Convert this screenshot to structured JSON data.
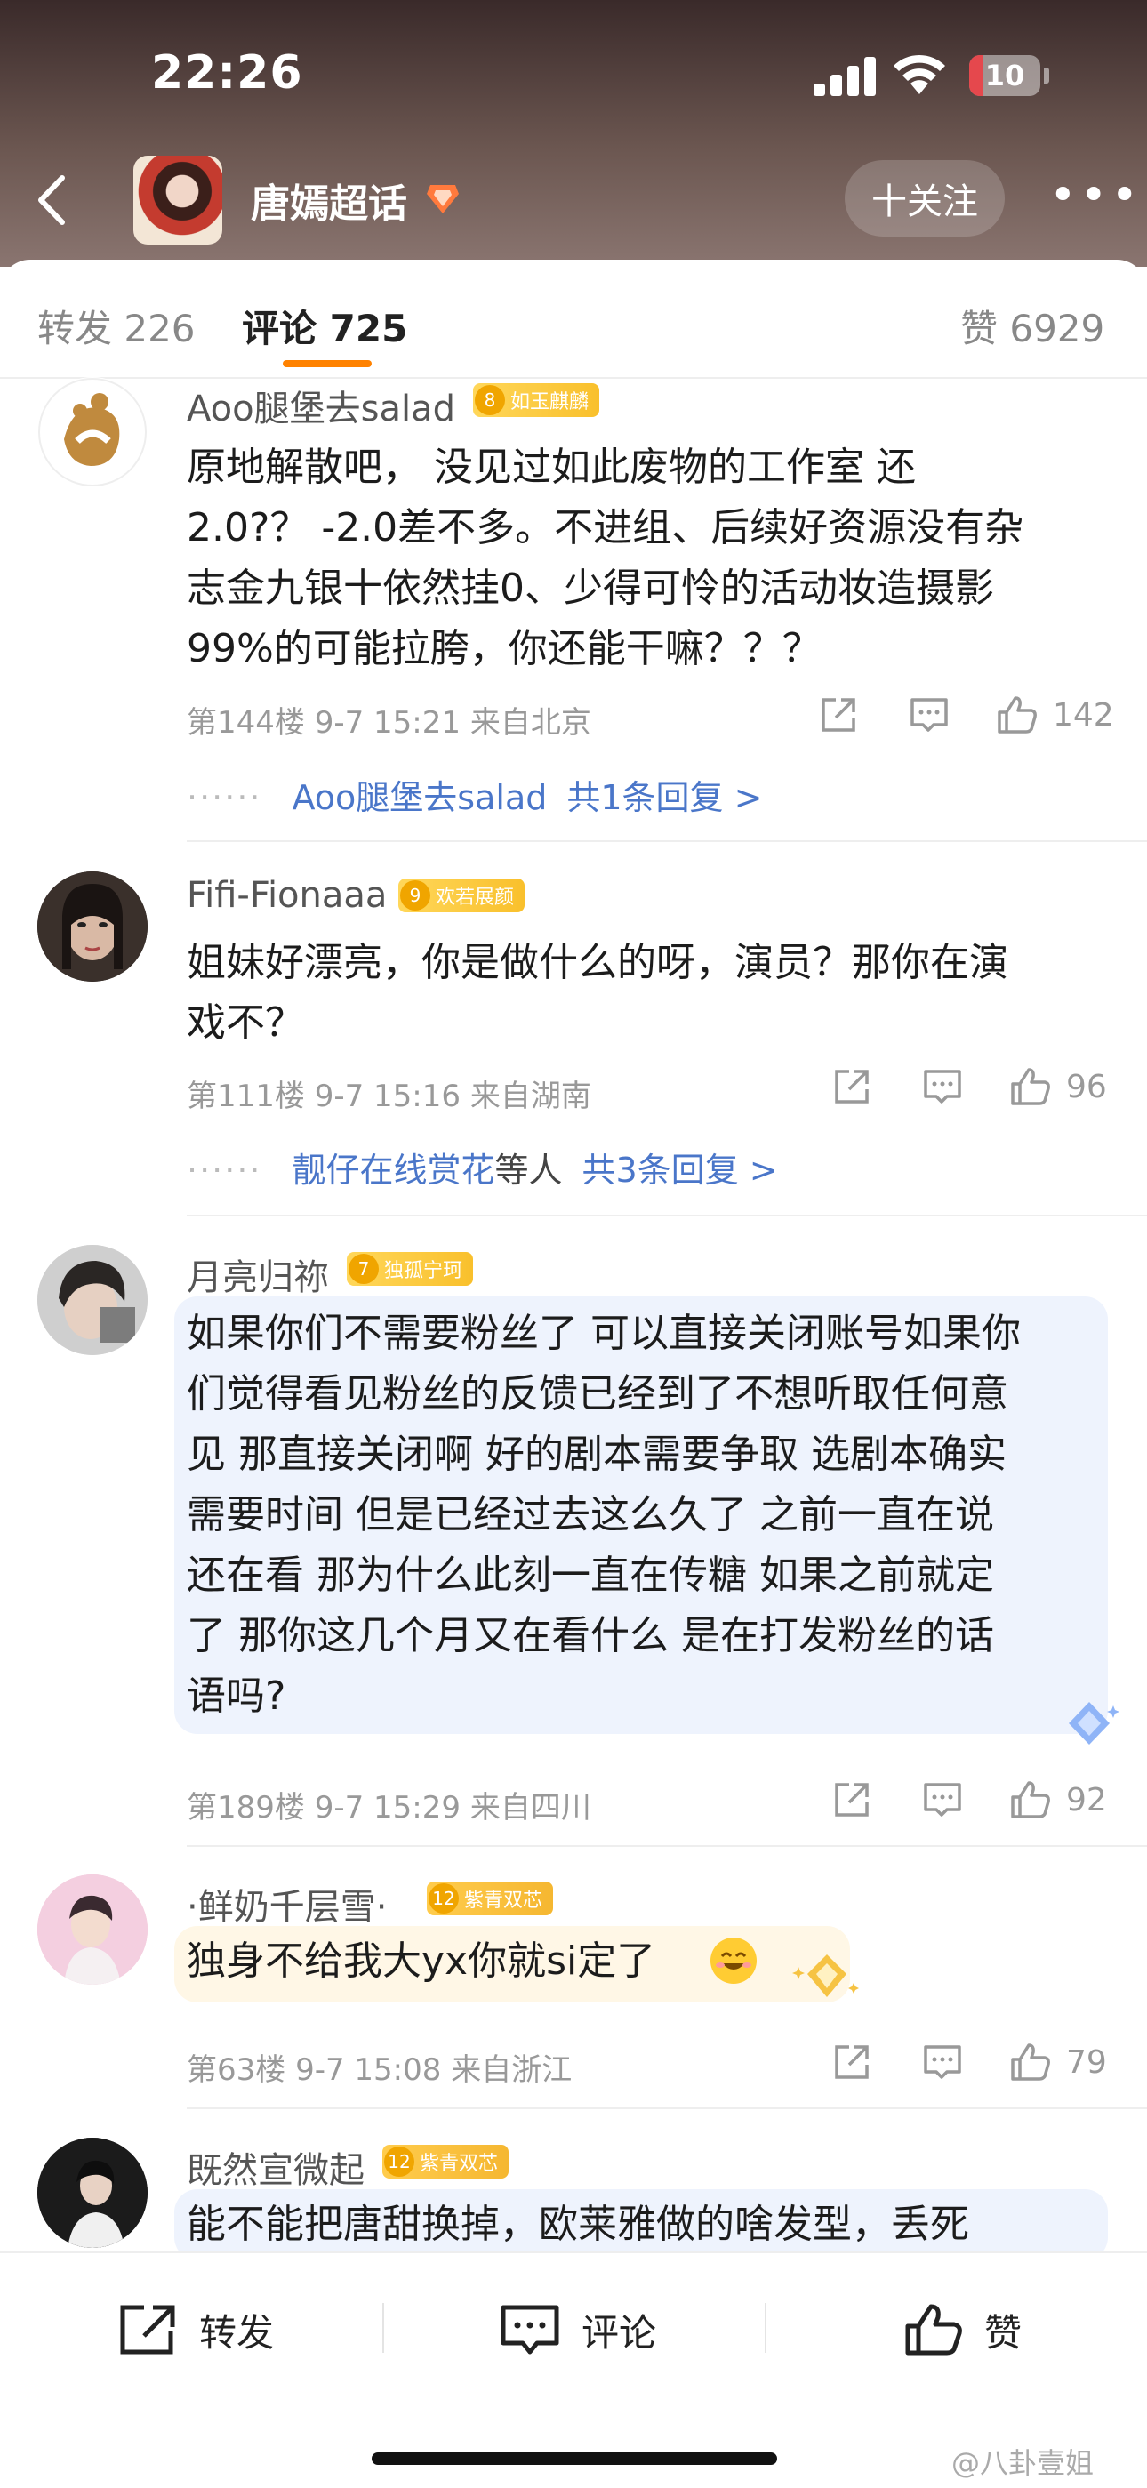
{
  "status_bar": {
    "time": "22:26",
    "battery": "10"
  },
  "header": {
    "title": "唐嫣超话",
    "follow_label": "十关注",
    "more_label": "•••"
  },
  "tabs": [
    {
      "label": "转发 226"
    },
    {
      "label": "评论 725"
    },
    {
      "label": "赞 6929"
    }
  ],
  "comments": [
    {
      "username": "Aoo腿堡去salad",
      "badge_level": "8",
      "badge_text": "如玉麒麟",
      "lines": [
        "原地解散吧， 没见过如此废物的工作室 还",
        "2.0?？ -2.0差不多。不进组、后续好资源没有杂",
        "志金九银十依然挂0、少得可怜的活动妆造摄影",
        "99%的可能拉胯，你还能干嘛？？？"
      ],
      "meta": "第144楼  9-7 15:21  来自北京",
      "likes": "142",
      "reply_user": "Aoo腿堡去salad",
      "reply_plain": "",
      "reply_count": "共1条回复 >"
    },
    {
      "username": "Fifi-Fionaaa",
      "badge_level": "9",
      "badge_text": "欢若展颜",
      "lines": [
        "姐妹好漂亮，你是做什么的呀，演员？那你在演",
        "戏不？"
      ],
      "meta": "第111楼  9-7 15:16  来自湖南",
      "likes": "96",
      "reply_user": "靓仔在线赏花",
      "reply_plain": "等人",
      "reply_count": "共3条回复 >"
    },
    {
      "username": "月亮归祢",
      "badge_level": "7",
      "badge_text": "独孤宁珂",
      "lines": [
        "如果你们不需要粉丝了 可以直接关闭账号如果你",
        "们觉得看见粉丝的反馈已经到了不想听取任何意",
        "见 那直接关闭啊 好的剧本需要争取 选剧本确实",
        "需要时间 但是已经过去这么久了 之前一直在说",
        "还在看 那为什么此刻一直在传糖 如果之前就定",
        "了 那你这几个月又在看什么 是在打发粉丝的话",
        "语吗?"
      ],
      "meta": "第189楼  9-7 15:29  来自四川",
      "likes": "92"
    },
    {
      "username": "·鲜奶千层雪·",
      "badge_level": "12",
      "badge_text": "紫青双芯",
      "lines": [
        "独身不给我大yx你就si定了"
      ],
      "meta": "第63楼  9-7 15:08  来自浙江",
      "likes": "79"
    },
    {
      "username": "既然宣微起",
      "badge_level": "12",
      "badge_text": "紫青双芯",
      "lines": [
        "能不能把唐甜换掉，欧莱雅做的啥发型，丢死"
      ]
    }
  ],
  "bottom_bar": {
    "repost": "转发",
    "comment": "评论",
    "like": "赞"
  },
  "watermark": "@八卦壹姐",
  "colors": {
    "accent": "#ff8200",
    "link": "#4a76c9",
    "badge": "#f9c02c"
  }
}
